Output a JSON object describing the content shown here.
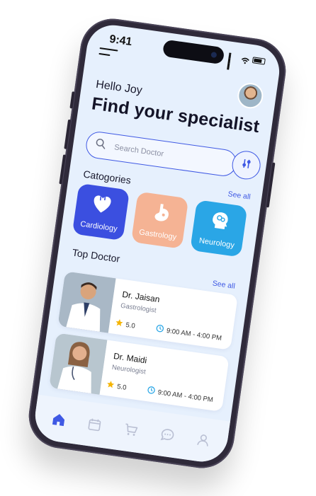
{
  "status_bar": {
    "time": "9:41"
  },
  "header": {
    "greeting": "Hello Joy",
    "title": "Find your specialist"
  },
  "search": {
    "placeholder": "Search Doctor"
  },
  "categories": {
    "heading": "Catogories",
    "see_all": "See all",
    "items": [
      {
        "label": "Cardiology",
        "icon": "heart-icon",
        "color": "#3b4fe0"
      },
      {
        "label": "Gastrology",
        "icon": "stomach-icon",
        "color": "#f5b394"
      },
      {
        "label": "Neurology",
        "icon": "brain-icon",
        "color": "#2aa6e6"
      }
    ]
  },
  "top_doctor": {
    "heading": "Top Doctor",
    "see_all": "See all",
    "doctors": [
      {
        "name": "Dr. Jaisan",
        "specialty": "Gastrologist",
        "rating": "5.0",
        "hours": "9:00 AM - 4:00 PM"
      },
      {
        "name": "Dr. Maidi",
        "specialty": "Neurologist",
        "rating": "5.0",
        "hours": "9:00 AM - 4:00 PM"
      }
    ]
  },
  "tabbar": {
    "items": [
      "home-icon",
      "calendar-icon",
      "cart-icon",
      "chat-icon",
      "profile-icon"
    ],
    "active_color": "#3f59e4",
    "inactive_color": "#b9bfd3"
  }
}
